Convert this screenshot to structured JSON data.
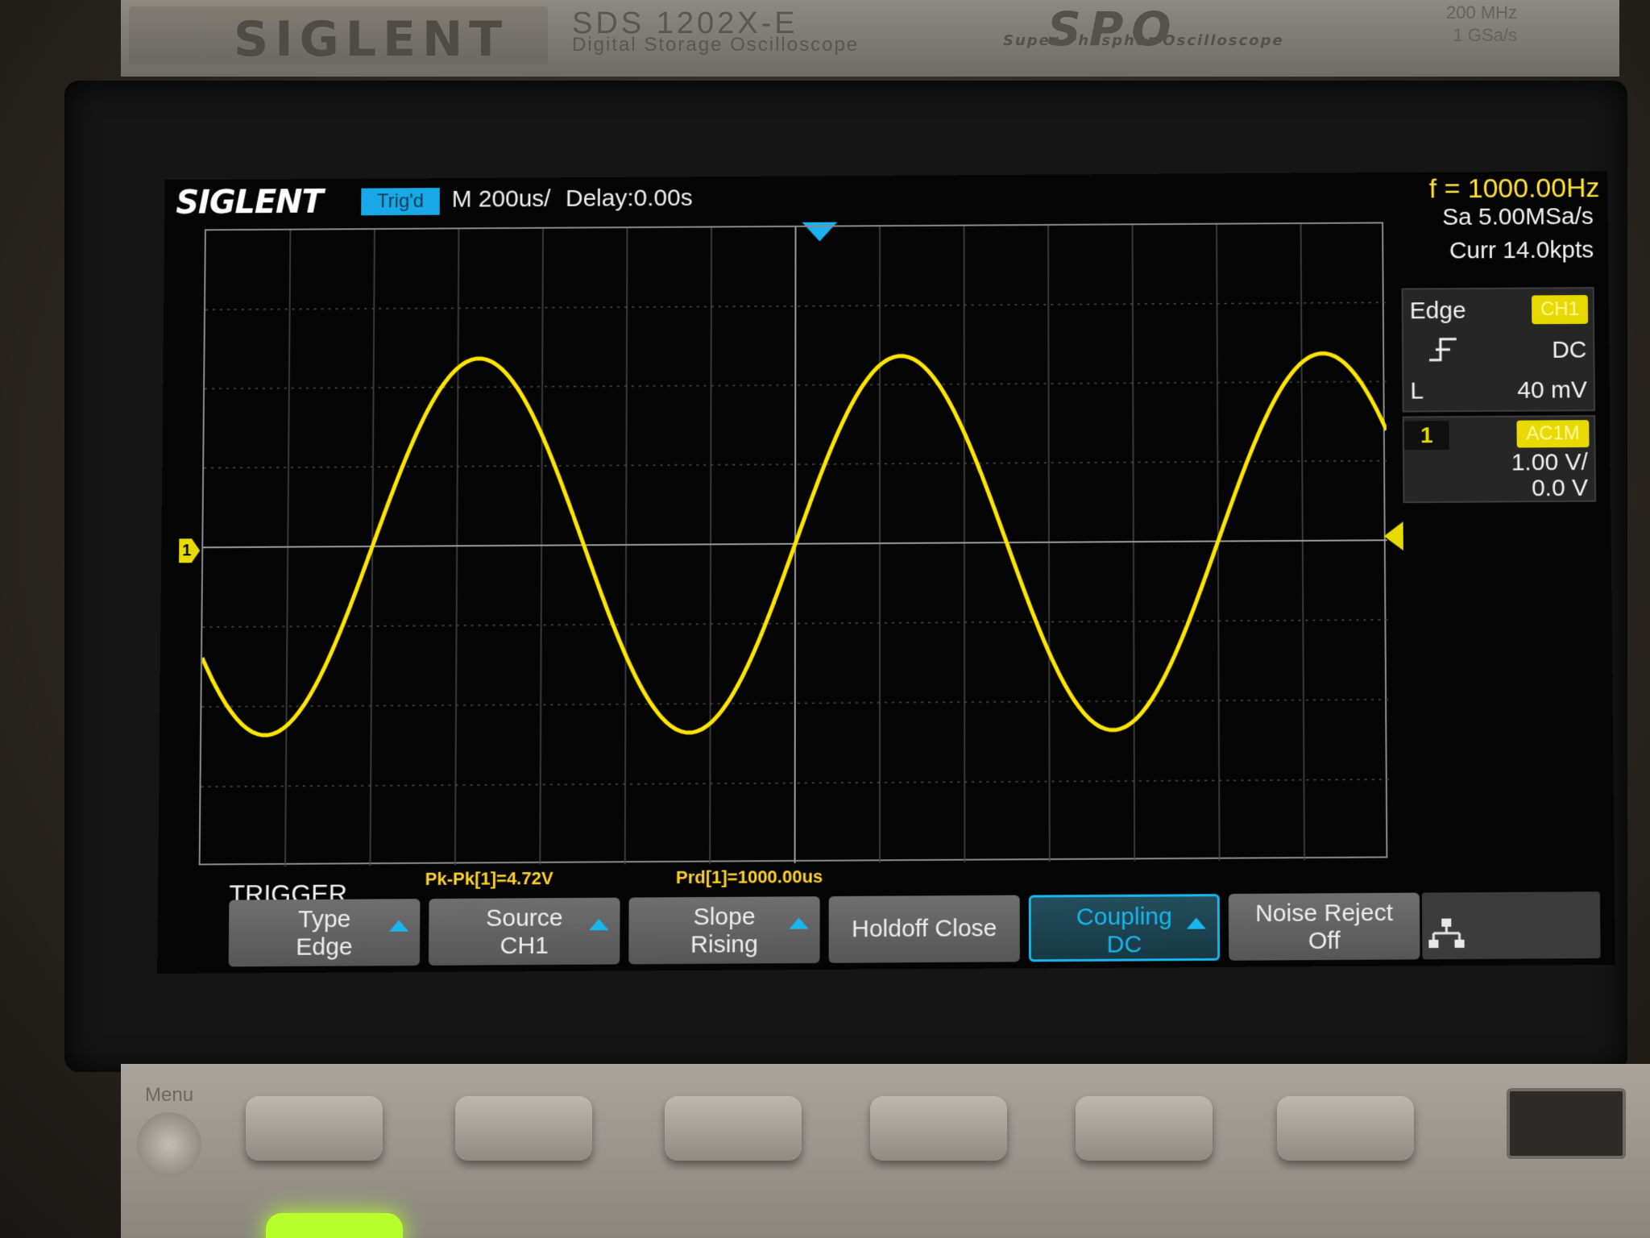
{
  "device": {
    "brand": "SIGLENT",
    "model": "SDS 1202X-E",
    "model_sub": "Digital Storage Oscilloscope",
    "spo_logo": "SPO",
    "spo_sub": "Super Phosphor Oscilloscope",
    "bandwidth": "200 MHz",
    "sample_rate_spec": "1 GSa/s",
    "menu_label": "Menu"
  },
  "screen": {
    "logo": "SIGLENT",
    "trigger_status": "Trig'd",
    "timebase": "M 200us/",
    "delay": "Delay:0.00s",
    "frequency": "f = 1000.00Hz",
    "sample_rate": "Sa 5.00MSa/s",
    "memory_depth": "Curr 14.0kpts"
  },
  "trigger_panel": {
    "type": "Edge",
    "source": "CH1",
    "slope_icon": "rising-edge-icon",
    "coupling": "DC",
    "level_prefix": "L",
    "level": "40 mV"
  },
  "channel_panel": {
    "number": "1",
    "coupling": "AC1M",
    "scale": "1.00 V/",
    "offset": "0.0 V",
    "level_marker": "1"
  },
  "measurements": {
    "pk_pk": "Pk-Pk[1]=4.72V",
    "period": "Prd[1]=1000.00us"
  },
  "menu": {
    "title": "TRIGGER",
    "buttons": [
      {
        "line1": "Type",
        "line2": "Edge",
        "knob": true,
        "active": false
      },
      {
        "line1": "Source",
        "line2": "CH1",
        "knob": true,
        "active": false
      },
      {
        "line1": "Slope",
        "line2": "Rising",
        "knob": true,
        "active": false
      },
      {
        "line1": "Holdoff Close",
        "line2": "",
        "knob": false,
        "active": false
      },
      {
        "line1": "Coupling",
        "line2": "DC",
        "knob": true,
        "active": true
      },
      {
        "line1": "Noise Reject",
        "line2": "Off",
        "knob": false,
        "active": false
      }
    ],
    "network_icon": "network-icon"
  },
  "colors": {
    "trace": "#ffe600",
    "accent": "#19b6ee",
    "measurement": "#ffd12a"
  },
  "chart_data": {
    "type": "line",
    "title": "",
    "xlabel": "",
    "ylabel": "",
    "time_per_div_us": 200,
    "volts_per_div": 1.0,
    "xlim_us": [
      -1400,
      1400
    ],
    "ylim_v": [
      -4,
      4
    ],
    "series": [
      {
        "name": "CH1",
        "waveform": "sine",
        "frequency_hz": 1000,
        "amplitude_v": 2.36,
        "offset_v": 0.0,
        "rising_zero_crossing_us": 0
      }
    ]
  }
}
